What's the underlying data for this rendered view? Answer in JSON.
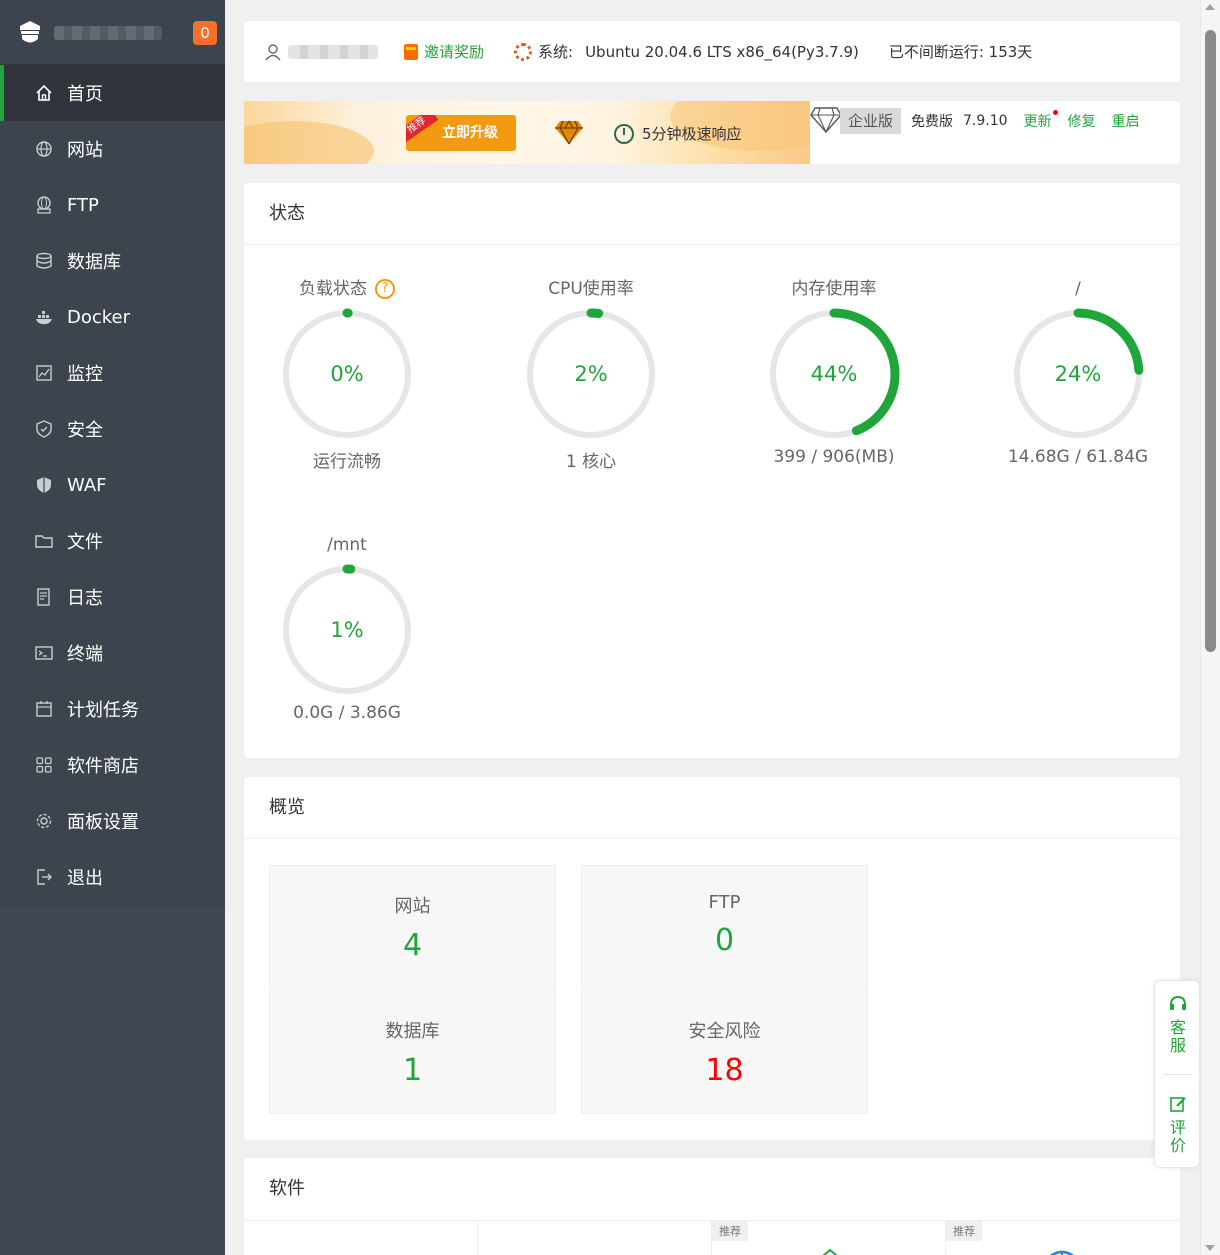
{
  "sidebar": {
    "message_count": "0",
    "items": [
      {
        "label": "首页",
        "icon": "home-icon"
      },
      {
        "label": "网站",
        "icon": "globe-icon"
      },
      {
        "label": "FTP",
        "icon": "ftp-icon"
      },
      {
        "label": "数据库",
        "icon": "database-icon"
      },
      {
        "label": "Docker",
        "icon": "docker-icon"
      },
      {
        "label": "监控",
        "icon": "monitor-icon"
      },
      {
        "label": "安全",
        "icon": "shield-icon"
      },
      {
        "label": "WAF",
        "icon": "waf-shield-icon"
      },
      {
        "label": "文件",
        "icon": "folder-icon"
      },
      {
        "label": "日志",
        "icon": "log-icon"
      },
      {
        "label": "终端",
        "icon": "terminal-icon"
      },
      {
        "label": "计划任务",
        "icon": "calendar-icon"
      },
      {
        "label": "软件商店",
        "icon": "apps-icon"
      },
      {
        "label": "面板设置",
        "icon": "gear-icon"
      },
      {
        "label": "退出",
        "icon": "logout-icon"
      }
    ]
  },
  "topbar": {
    "invite_label": "邀请奖励",
    "system_label": "系统:",
    "system_value": "Ubuntu 20.04.6 LTS x86_64(Py3.7.9)",
    "uptime": "已不间断运行: 153天"
  },
  "banner": {
    "recommend_tag": "推荐",
    "upgrade_label": "立即升级",
    "fast_response": "5分钟极速响应",
    "enterprise_label": "企业版",
    "free_label": "免费版",
    "version": "7.9.10",
    "update_label": "更新",
    "repair_label": "修复",
    "restart_label": "重启"
  },
  "status": {
    "title": "状态",
    "gauges": [
      {
        "title": "负载状态",
        "value": "0%",
        "percent": 0,
        "sub": "运行流畅",
        "help": "?"
      },
      {
        "title": "CPU使用率",
        "value": "2%",
        "percent": 2,
        "sub": "1 核心"
      },
      {
        "title": "内存使用率",
        "value": "44%",
        "percent": 44,
        "sub": "399 / 906(MB)"
      },
      {
        "title": "/",
        "value": "24%",
        "percent": 24,
        "sub": "14.68G / 61.84G"
      },
      {
        "title": "/mnt",
        "value": "1%",
        "percent": 1,
        "sub": "0.0G / 3.86G"
      }
    ]
  },
  "overview": {
    "title": "概览",
    "boxes": [
      {
        "label": "网站",
        "value": "4"
      },
      {
        "label": "FTP",
        "value": "0"
      },
      {
        "label": "数据库",
        "value": "1"
      },
      {
        "label": "安全风险",
        "value": "18"
      }
    ]
  },
  "software": {
    "title": "软件",
    "recommend_tags": [
      "推荐",
      "推荐"
    ]
  },
  "float": {
    "service_label": "客服",
    "review_label": "评价"
  },
  "colors": {
    "accent": "#20a53a",
    "sidebar": "#3c444d",
    "danger": "#ff0000",
    "badge": "#f5712b"
  }
}
